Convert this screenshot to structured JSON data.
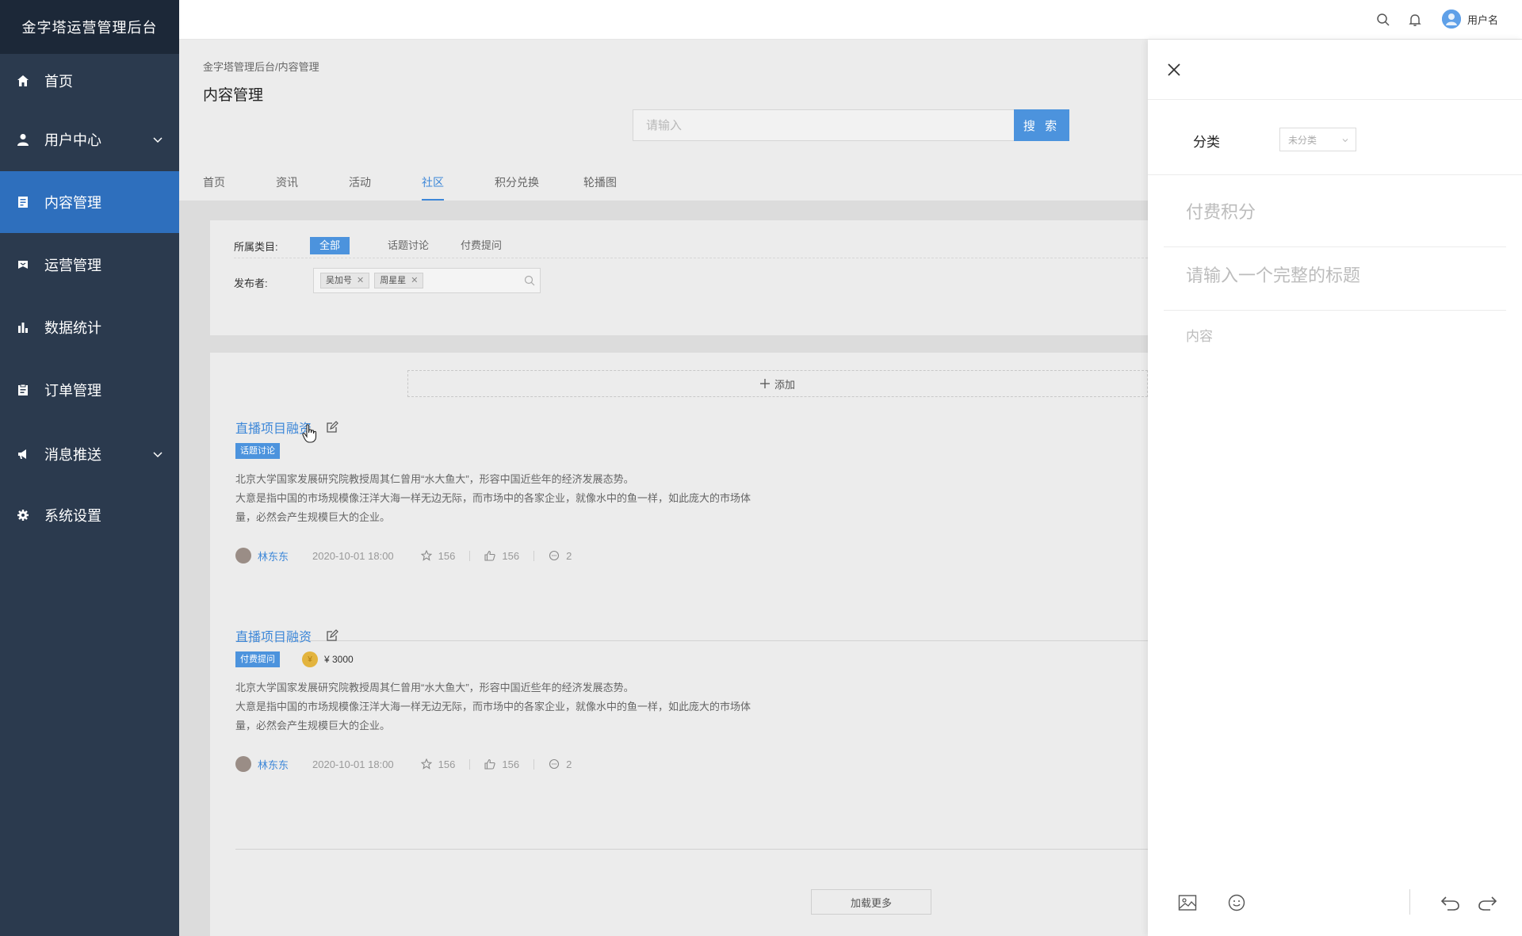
{
  "app": {
    "title": "金字塔运营管理后台"
  },
  "sidebar": {
    "items": [
      {
        "label": "首页",
        "icon": "home-icon"
      },
      {
        "label": "用户中心",
        "icon": "user-icon",
        "expandable": true
      },
      {
        "label": "内容管理",
        "icon": "document-icon",
        "active": true
      },
      {
        "label": "运营管理",
        "icon": "flag-icon"
      },
      {
        "label": "数据统计",
        "icon": "bar-chart-icon"
      },
      {
        "label": "订单管理",
        "icon": "clipboard-icon"
      },
      {
        "label": "消息推送",
        "icon": "megaphone-icon",
        "expandable": true
      },
      {
        "label": "系统设置",
        "icon": "gear-icon"
      }
    ]
  },
  "header": {
    "username": "用户名"
  },
  "page": {
    "breadcrumb": "金字塔管理后台/内容管理",
    "title": "内容管理",
    "search_placeholder": "请输入",
    "search_button": "搜 索",
    "tabs": [
      {
        "label": "首页"
      },
      {
        "label": "资讯"
      },
      {
        "label": "活动"
      },
      {
        "label": "社区",
        "active": true
      },
      {
        "label": "积分兑换"
      },
      {
        "label": "轮播图"
      }
    ]
  },
  "filters": {
    "category_label": "所属类目:",
    "categories": [
      {
        "label": "全部",
        "selected": true
      },
      {
        "label": "话题讨论"
      },
      {
        "label": "付费提问"
      }
    ],
    "publisher_label": "发布者:",
    "publishers": [
      "吴加号",
      "周星星"
    ]
  },
  "list": {
    "add_label": "添加",
    "load_more": "加载更多",
    "posts": [
      {
        "title": "直播项目融资",
        "tag": "话题讨论",
        "body_lines": [
          "北京大学国家发展研究院教授周其仁曾用“水大鱼大”，形容中国近些年的经济发展态势。",
          "大意是指中国的市场规模像汪洋大海一样无边无际，而市场中的各家企业，就像水中的鱼一样，如此庞大的市场体",
          "量，必然会产生规模巨大的企业。"
        ],
        "author": "林东东",
        "date": "2020-10-01 18:00",
        "favorites": "156",
        "likes": "156",
        "comments": "2"
      },
      {
        "title": "直播项目融资",
        "tag": "付费提问",
        "price": "¥ 3000",
        "body_lines": [
          "北京大学国家发展研究院教授周其仁曾用“水大鱼大”，形容中国近些年的经济发展态势。",
          "大意是指中国的市场规模像汪洋大海一样无边无际，而市场中的各家企业，就像水中的鱼一样，如此庞大的市场体",
          "量，必然会产生规模巨大的企业。"
        ],
        "author": "林东东",
        "date": "2020-10-01 18:00",
        "favorites": "156",
        "likes": "156",
        "comments": "2"
      }
    ]
  },
  "drawer": {
    "category_label": "分类",
    "category_value": "未分类",
    "points_placeholder": "付费积分",
    "title_placeholder": "请输入一个完整的标题",
    "content_placeholder": "内容"
  },
  "colors": {
    "sidebar_bg": "#2b3a4e",
    "brand_bg": "#1c2838",
    "accent": "#4c93dd",
    "link": "#3d87d8"
  }
}
